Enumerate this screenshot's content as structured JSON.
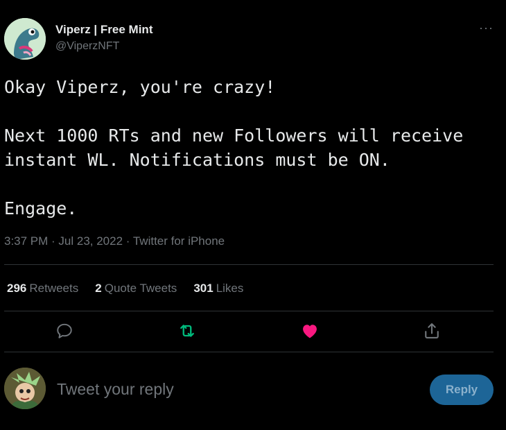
{
  "author": {
    "name": "Viperz | Free Mint",
    "handle": "@ViperzNFT",
    "more_label": "···"
  },
  "tweet": {
    "text": "Okay Viperz, you're crazy!\n\nNext 1000 RTs and new Followers will receive instant WL. Notifications must be ON.\n\nEngage.",
    "meta": "3:37 PM · Jul 23, 2022 · Twitter for iPhone"
  },
  "stats": {
    "retweets_count": "296",
    "retweets_label": "Retweets",
    "quotes_count": "2",
    "quotes_label": "Quote Tweets",
    "likes_count": "301",
    "likes_label": "Likes"
  },
  "actions": {
    "reply_icon": "reply-icon",
    "retweet_icon": "retweet-icon",
    "like_icon": "heart-icon",
    "share_icon": "share-icon",
    "retweet_color": "#00ba7c",
    "like_color": "#f91880"
  },
  "reply_box": {
    "placeholder": "Tweet your reply",
    "button_label": "Reply"
  }
}
